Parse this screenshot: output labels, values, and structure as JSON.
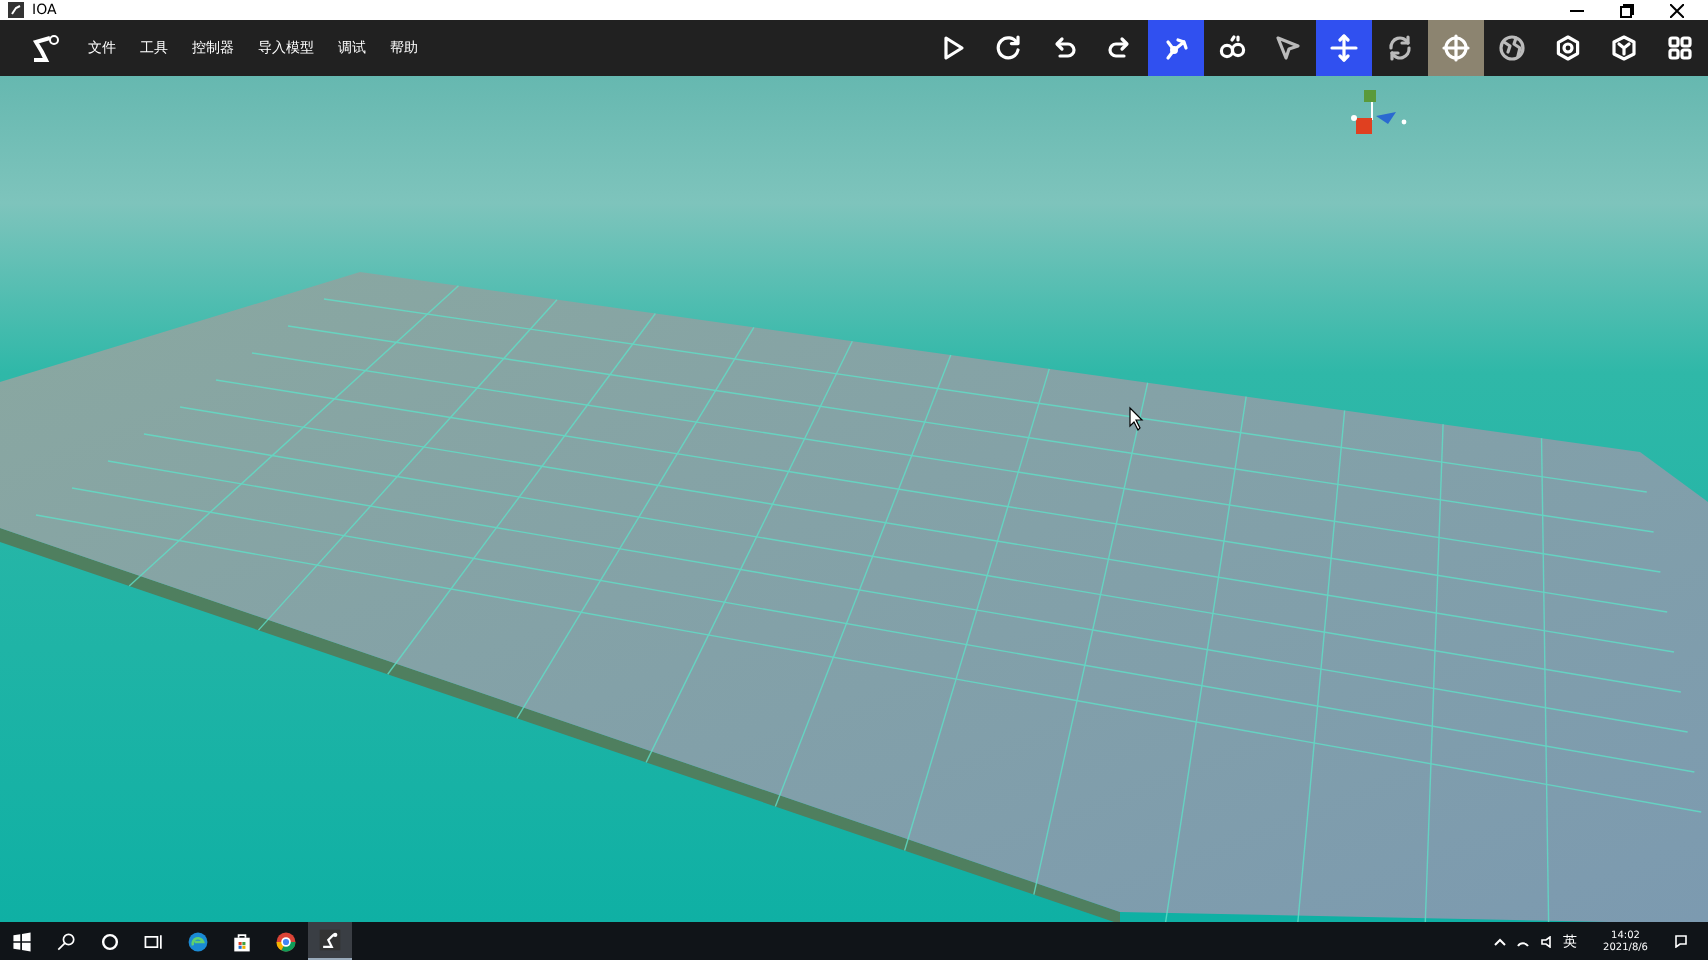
{
  "window": {
    "title": "IOA"
  },
  "menu": [
    {
      "label": "文件"
    },
    {
      "label": "工具"
    },
    {
      "label": "控制器"
    },
    {
      "label": "导入模型"
    },
    {
      "label": "调试"
    },
    {
      "label": "帮助"
    }
  ],
  "tools": [
    {
      "kind": "play",
      "selected": false,
      "highlighted": false
    },
    {
      "kind": "refresh",
      "selected": false,
      "highlighted": false
    },
    {
      "kind": "undo",
      "selected": false,
      "highlighted": false
    },
    {
      "kind": "redo",
      "selected": false,
      "highlighted": false
    },
    {
      "kind": "robot",
      "selected": true,
      "highlighted": false
    },
    {
      "kind": "gears",
      "selected": false,
      "highlighted": false
    },
    {
      "kind": "pointer",
      "selected": false,
      "highlighted": false
    },
    {
      "kind": "move",
      "selected": true,
      "highlighted": false
    },
    {
      "kind": "rotate",
      "selected": false,
      "highlighted": false
    },
    {
      "kind": "target",
      "selected": false,
      "highlighted": true
    },
    {
      "kind": "globe",
      "selected": false,
      "highlighted": false
    },
    {
      "kind": "gear",
      "selected": false,
      "highlighted": false
    },
    {
      "kind": "cube",
      "selected": false,
      "highlighted": false
    },
    {
      "kind": "grid",
      "selected": false,
      "highlighted": false
    }
  ],
  "taskbar": {
    "apps": [
      {
        "kind": "start",
        "active": false
      },
      {
        "kind": "search",
        "active": false
      },
      {
        "kind": "cortana",
        "active": false
      },
      {
        "kind": "taskview",
        "active": false
      },
      {
        "kind": "edge",
        "active": false
      },
      {
        "kind": "store",
        "active": false
      },
      {
        "kind": "chrome",
        "active": false
      },
      {
        "kind": "app",
        "active": true
      }
    ],
    "ime": "英",
    "time": "14:02",
    "date": "2021/8/6"
  }
}
